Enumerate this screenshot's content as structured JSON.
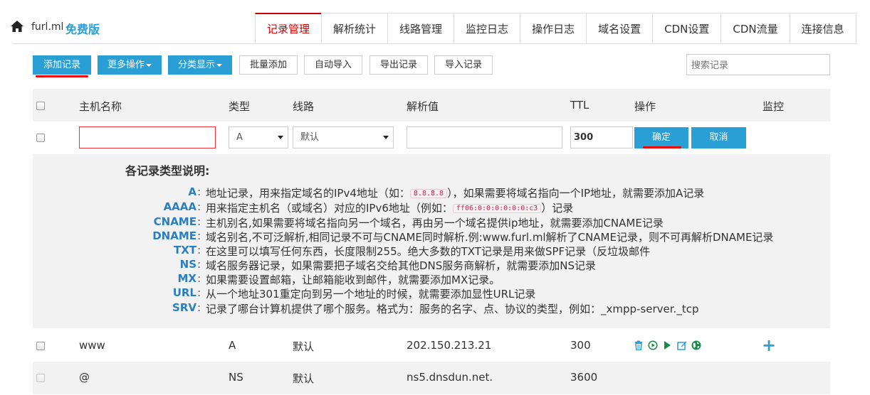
{
  "header": {
    "domain": "furl.ml",
    "edition": "免费版",
    "tabs": [
      "记录管理",
      "解析统计",
      "线路管理",
      "监控日志",
      "操作日志",
      "域名设置",
      "CDN设置",
      "CDN流量",
      "连接信息"
    ],
    "active_tab": 0
  },
  "toolbar": {
    "add_record": "添加记录",
    "more_actions": "更多操作",
    "group_display": "分类显示",
    "batch_add": "批量添加",
    "auto_import": "自动导入",
    "export_records": "导出记录",
    "import_records": "导入记录",
    "search_placeholder": "搜索记录"
  },
  "table": {
    "columns": [
      "主机名称",
      "类型",
      "线路",
      "解析值",
      "TTL",
      "操作",
      "监控"
    ]
  },
  "add_form": {
    "host_value": "",
    "type_value": "A",
    "line_value": "默认",
    "record_value": "",
    "ttl_value": "300",
    "confirm": "确定",
    "cancel": "取消"
  },
  "help": {
    "title": "各记录类型说明:",
    "items": [
      {
        "type": "A",
        "desc_before": "地址记录，用来指定域名的IPv4地址（如：",
        "code": "8.8.8.8",
        "desc_after": "），如果需要将域名指向一个IP地址，就需要添加A记录"
      },
      {
        "type": "AAAA",
        "desc_before": "用来指定主机名（或域名）对应的IPv6地址（例如：",
        "code": "ff06:0:0:0:0:0:0:c3",
        "desc_after": "）记录"
      },
      {
        "type": "CNAME",
        "desc_before": "主机别名,如果需要将域名指向另一个域名，再由另一个域名提供ip地址，就需要添加CNAME记录",
        "code": "",
        "desc_after": ""
      },
      {
        "type": "DNAME",
        "desc_before": "域名别名,不可泛解析,相同记录不可与CNAME同时解析.例:www.furl.ml解析了CNAME记录，则不可再解析DNAME记录",
        "code": "",
        "desc_after": ""
      },
      {
        "type": "TXT",
        "desc_before": "在这里可以填写任何东西，长度限制255。绝大多数的TXT记录是用来做SPF记录（反垃圾邮件",
        "code": "",
        "desc_after": ""
      },
      {
        "type": "NS",
        "desc_before": "域名服务器记录，如果需要把子域名交给其他DNS服务商解析，就需要添加NS记录",
        "code": "",
        "desc_after": ""
      },
      {
        "type": "MX",
        "desc_before": "如果需要设置邮箱，让邮箱能收到邮件，就需要添加MX记录。",
        "code": "",
        "desc_after": ""
      },
      {
        "type": "URL",
        "desc_before": "从一个地址301重定向到另一个地址的时候，就需要添加显性URL记录",
        "code": "",
        "desc_after": ""
      },
      {
        "type": "SRV",
        "desc_before": "记录了哪台计算机提供了哪个服务。格式为：服务的名字、点、协议的类型，例如：_xmpp-server._tcp",
        "code": "",
        "desc_after": ""
      }
    ]
  },
  "records": [
    {
      "host": "www",
      "type": "A",
      "line": "默认",
      "value": "202.150.213.21",
      "ttl": "300"
    },
    {
      "host": "@",
      "type": "NS",
      "line": "默认",
      "value": "ns5.dnsdun.net.",
      "ttl": "3600"
    }
  ],
  "colors": {
    "primary": "#2a9fd6",
    "active_tab": "#cc0000",
    "record_type": "#2a7fc0",
    "annotation": "#ee0000",
    "enable_green": "#1a8a4a"
  }
}
